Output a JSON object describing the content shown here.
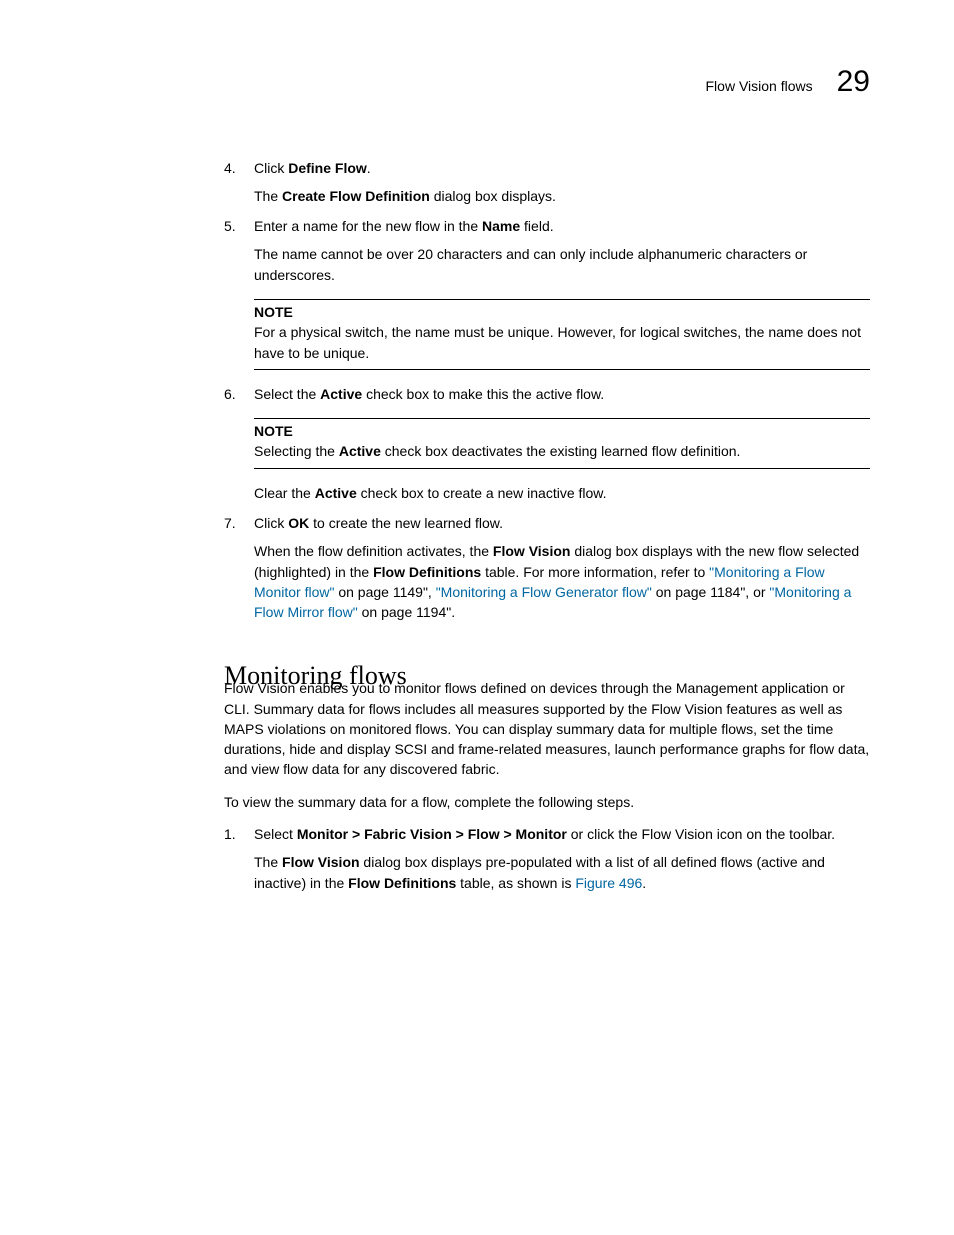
{
  "header": {
    "running_title": "Flow Vision flows",
    "page_number": "29"
  },
  "steps_a": [
    {
      "num": "4.",
      "text_pre": "Click ",
      "bold": "Define Flow",
      "text_post": ".",
      "subs": [
        {
          "pre": "The ",
          "bold": "Create Flow Definition",
          "post": " dialog box displays."
        }
      ]
    },
    {
      "num": "5.",
      "text_pre": "Enter a name for the new flow in the ",
      "bold": "Name",
      "text_post": " field.",
      "subs": [
        {
          "plain": "The name cannot be over 20 characters and can only include alphanumeric characters or underscores."
        }
      ],
      "note": {
        "label": "NOTE",
        "body": "For a physical switch, the name must be unique. However, for logical switches, the name does not have to be unique."
      }
    },
    {
      "num": "6.",
      "text_pre": "Select the ",
      "bold": "Active",
      "text_post": " check box to make this the active flow.",
      "note": {
        "label": "NOTE",
        "body_pre": "Selecting the ",
        "body_bold": "Active",
        "body_post": " check box deactivates the existing learned flow definition."
      },
      "subs_after_note": [
        {
          "pre": "Clear the ",
          "bold": "Active",
          "post": " check box to create a new inactive flow."
        }
      ]
    },
    {
      "num": "7.",
      "text_pre": "Click ",
      "bold": "OK",
      "text_post": " to create the new learned flow.",
      "complex_sub": {
        "t1": "When the flow definition activates, the ",
        "b1": "Flow Vision",
        "t2": " dialog box displays with the new flow selected (highlighted) in the ",
        "b2": "Flow Definitions",
        "t3": " table. For more information, refer to ",
        "l1": "\"Monitoring a Flow Monitor flow\"",
        "t4": " on page 1149\", ",
        "l2": "\"Monitoring a Flow Generator flow\"",
        "t5": " on page 1184\", or ",
        "l3": "\"Monitoring a Flow Mirror flow\"",
        "t6": " on page 1194\"."
      }
    }
  ],
  "section_heading": "Monitoring flows",
  "section_intro": "Flow Vision enables you to monitor flows defined on devices through the Management application or CLI. Summary data for flows includes all measures supported by the Flow Vision features as well as MAPS violations on monitored flows. You can display summary data for multiple flows, set the time durations, hide and display SCSI and frame-related measures, launch performance graphs for flow data, and view flow data for any discovered fabric.",
  "section_lead": "To view the summary data for a flow, complete the following steps.",
  "steps_b": [
    {
      "num": "1.",
      "t1": "Select ",
      "b1": "Monitor > Fabric Vision > Flow > Monitor",
      "t2": " or click the Flow Vision icon on the toolbar.",
      "sub": {
        "t1": "The ",
        "b1": "Flow Vision",
        "t2": " dialog box displays pre-populated with a list of all defined flows (active and inactive) in the ",
        "b2": "Flow Definitions",
        "t3": " table, as shown is ",
        "l1": "Figure 496",
        "t4": "."
      }
    }
  ]
}
